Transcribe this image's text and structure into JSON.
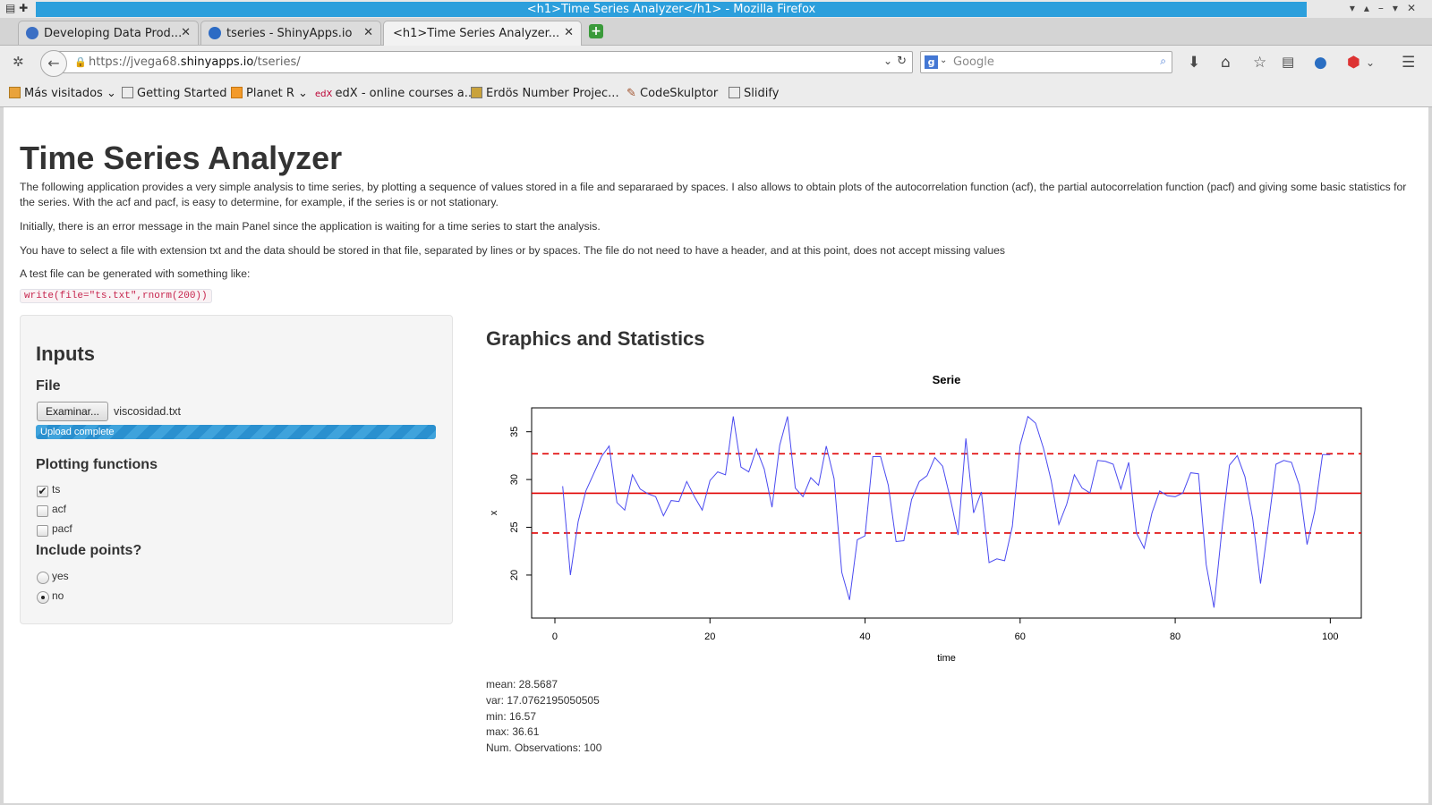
{
  "window": {
    "title": "<h1>Time Series Analyzer</h1> - Mozilla Firefox",
    "accent": "#2c9fdc"
  },
  "tabs": [
    {
      "label": "Developing Data Prod...",
      "icon": "chrome-icon",
      "active": false
    },
    {
      "label": "tseries - ShinyApps.io",
      "icon": "r-icon",
      "active": false
    },
    {
      "label": "<h1>Time Series Analyzer...",
      "icon": "",
      "active": true
    }
  ],
  "navbar": {
    "url_prefix": "https://jvega68.",
    "url_domain": "shinyapps.io",
    "url_path": "/tseries/",
    "search_placeholder": "Google"
  },
  "bookmarks": [
    {
      "label": "Más visitados",
      "icon": "folder-icon"
    },
    {
      "label": "Getting Started",
      "icon": "page-icon"
    },
    {
      "label": "Planet R",
      "icon": "rss-icon"
    },
    {
      "label": "edX - online courses a...",
      "icon": "edx-icon"
    },
    {
      "label": "Erdös Number Projec...",
      "icon": "ph-icon"
    },
    {
      "label": "CodeSkulptor",
      "icon": "pencil-icon"
    },
    {
      "label": "Slidify",
      "icon": "page-icon"
    }
  ],
  "page": {
    "title": "Time Series Analyzer",
    "intro": "The following application provides a very simple analysis to time series, by plotting a sequence of values stored in a file and separaraed by spaces. I also allows to obtain plots of the autocorrelation function (acf), the partial autocorrelation function (pacf) and giving some basic statistics for the series. With the acf and pacf, is easy to determine, for example, if the series is or not stationary.",
    "p2": "Initially, there is an error message in the main Panel since the application is waiting for a time series to start the analysis.",
    "p3": "You have to select a file with extension txt and the data should be stored in that file, separated by lines or by spaces. The file do not need to have a header, and at this point, does not accept missing values",
    "p4": "A test file can be generated with something like:",
    "code": "write(file=\"ts.txt\",rnorm(200))"
  },
  "sidebar": {
    "heading": "Inputs",
    "file_label": "File",
    "browse_label": "Examinar...",
    "file_name": "viscosidad.txt",
    "upload_status": "Upload complete",
    "upload_progress": 1.0,
    "plotting_label": "Plotting functions",
    "plot_options": [
      {
        "label": "ts",
        "checked": true
      },
      {
        "label": "acf",
        "checked": false
      },
      {
        "label": "pacf",
        "checked": false
      }
    ],
    "points_label": "Include points?",
    "points_options": [
      {
        "label": "yes",
        "selected": false
      },
      {
        "label": "no",
        "selected": true
      }
    ]
  },
  "main": {
    "heading": "Graphics and Statistics",
    "stats": [
      "mean: 28.5687",
      "var: 17.0762195050505",
      "min: 16.57",
      "max: 36.61",
      "Num. Observations: 100"
    ]
  },
  "chart_data": {
    "type": "line",
    "title": "Serie",
    "xlabel": "time",
    "ylabel": "x",
    "xlim": [
      -3,
      104
    ],
    "ylim": [
      15.5,
      37.5
    ],
    "xticks": [
      0,
      20,
      40,
      60,
      80,
      100
    ],
    "yticks": [
      20,
      25,
      30,
      35
    ],
    "series_color": "#4a4af0",
    "hlines": [
      {
        "value": 28.57,
        "style": "solid",
        "color": "#e00000"
      },
      {
        "value": 32.7,
        "style": "dashed",
        "color": "#e00000"
      },
      {
        "value": 24.4,
        "style": "dashed",
        "color": "#e00000"
      }
    ],
    "x": [
      1,
      2,
      3,
      4,
      5,
      6,
      7,
      8,
      9,
      10,
      11,
      12,
      13,
      14,
      15,
      16,
      17,
      18,
      19,
      20,
      21,
      22,
      23,
      24,
      25,
      26,
      27,
      28,
      29,
      30,
      31,
      32,
      33,
      34,
      35,
      36,
      37,
      38,
      39,
      40,
      41,
      42,
      43,
      44,
      45,
      46,
      47,
      48,
      49,
      50,
      51,
      52,
      53,
      54,
      55,
      56,
      57,
      58,
      59,
      60,
      61,
      62,
      63,
      64,
      65,
      66,
      67,
      68,
      69,
      70,
      71,
      72,
      73,
      74,
      75,
      76,
      77,
      78,
      79,
      80,
      81,
      82,
      83,
      84,
      85,
      86,
      87,
      88,
      89,
      90,
      91,
      92,
      93,
      94,
      95,
      96,
      97,
      98,
      99,
      100
    ],
    "values": [
      29.3,
      20.0,
      25.6,
      28.8,
      30.6,
      32.4,
      33.5,
      27.6,
      26.8,
      30.5,
      29.0,
      28.5,
      28.2,
      26.2,
      27.8,
      27.7,
      29.8,
      28.2,
      26.8,
      29.9,
      30.8,
      30.5,
      36.6,
      31.3,
      30.8,
      33.2,
      31.1,
      27.1,
      33.6,
      36.6,
      29.1,
      28.2,
      30.2,
      29.4,
      33.5,
      30.1,
      20.3,
      17.4,
      23.7,
      24.1,
      32.4,
      32.4,
      29.4,
      23.5,
      23.6,
      27.9,
      29.8,
      30.4,
      32.3,
      31.4,
      28.0,
      24.2,
      34.3,
      26.5,
      28.7,
      21.3,
      21.7,
      21.5,
      25.1,
      33.6,
      36.6,
      35.9,
      33.3,
      29.9,
      25.3,
      27.4,
      30.5,
      29.1,
      28.6,
      32.0,
      31.9,
      31.6,
      29.0,
      31.8,
      24.4,
      22.8,
      26.5,
      28.8,
      28.3,
      28.2,
      28.6,
      30.7,
      30.6,
      21.1,
      16.6,
      24.6,
      31.5,
      32.5,
      30.3,
      25.9,
      19.1,
      25.2,
      31.6,
      32.0,
      31.8,
      29.4,
      23.2,
      26.7,
      32.6,
      32.6
    ]
  }
}
